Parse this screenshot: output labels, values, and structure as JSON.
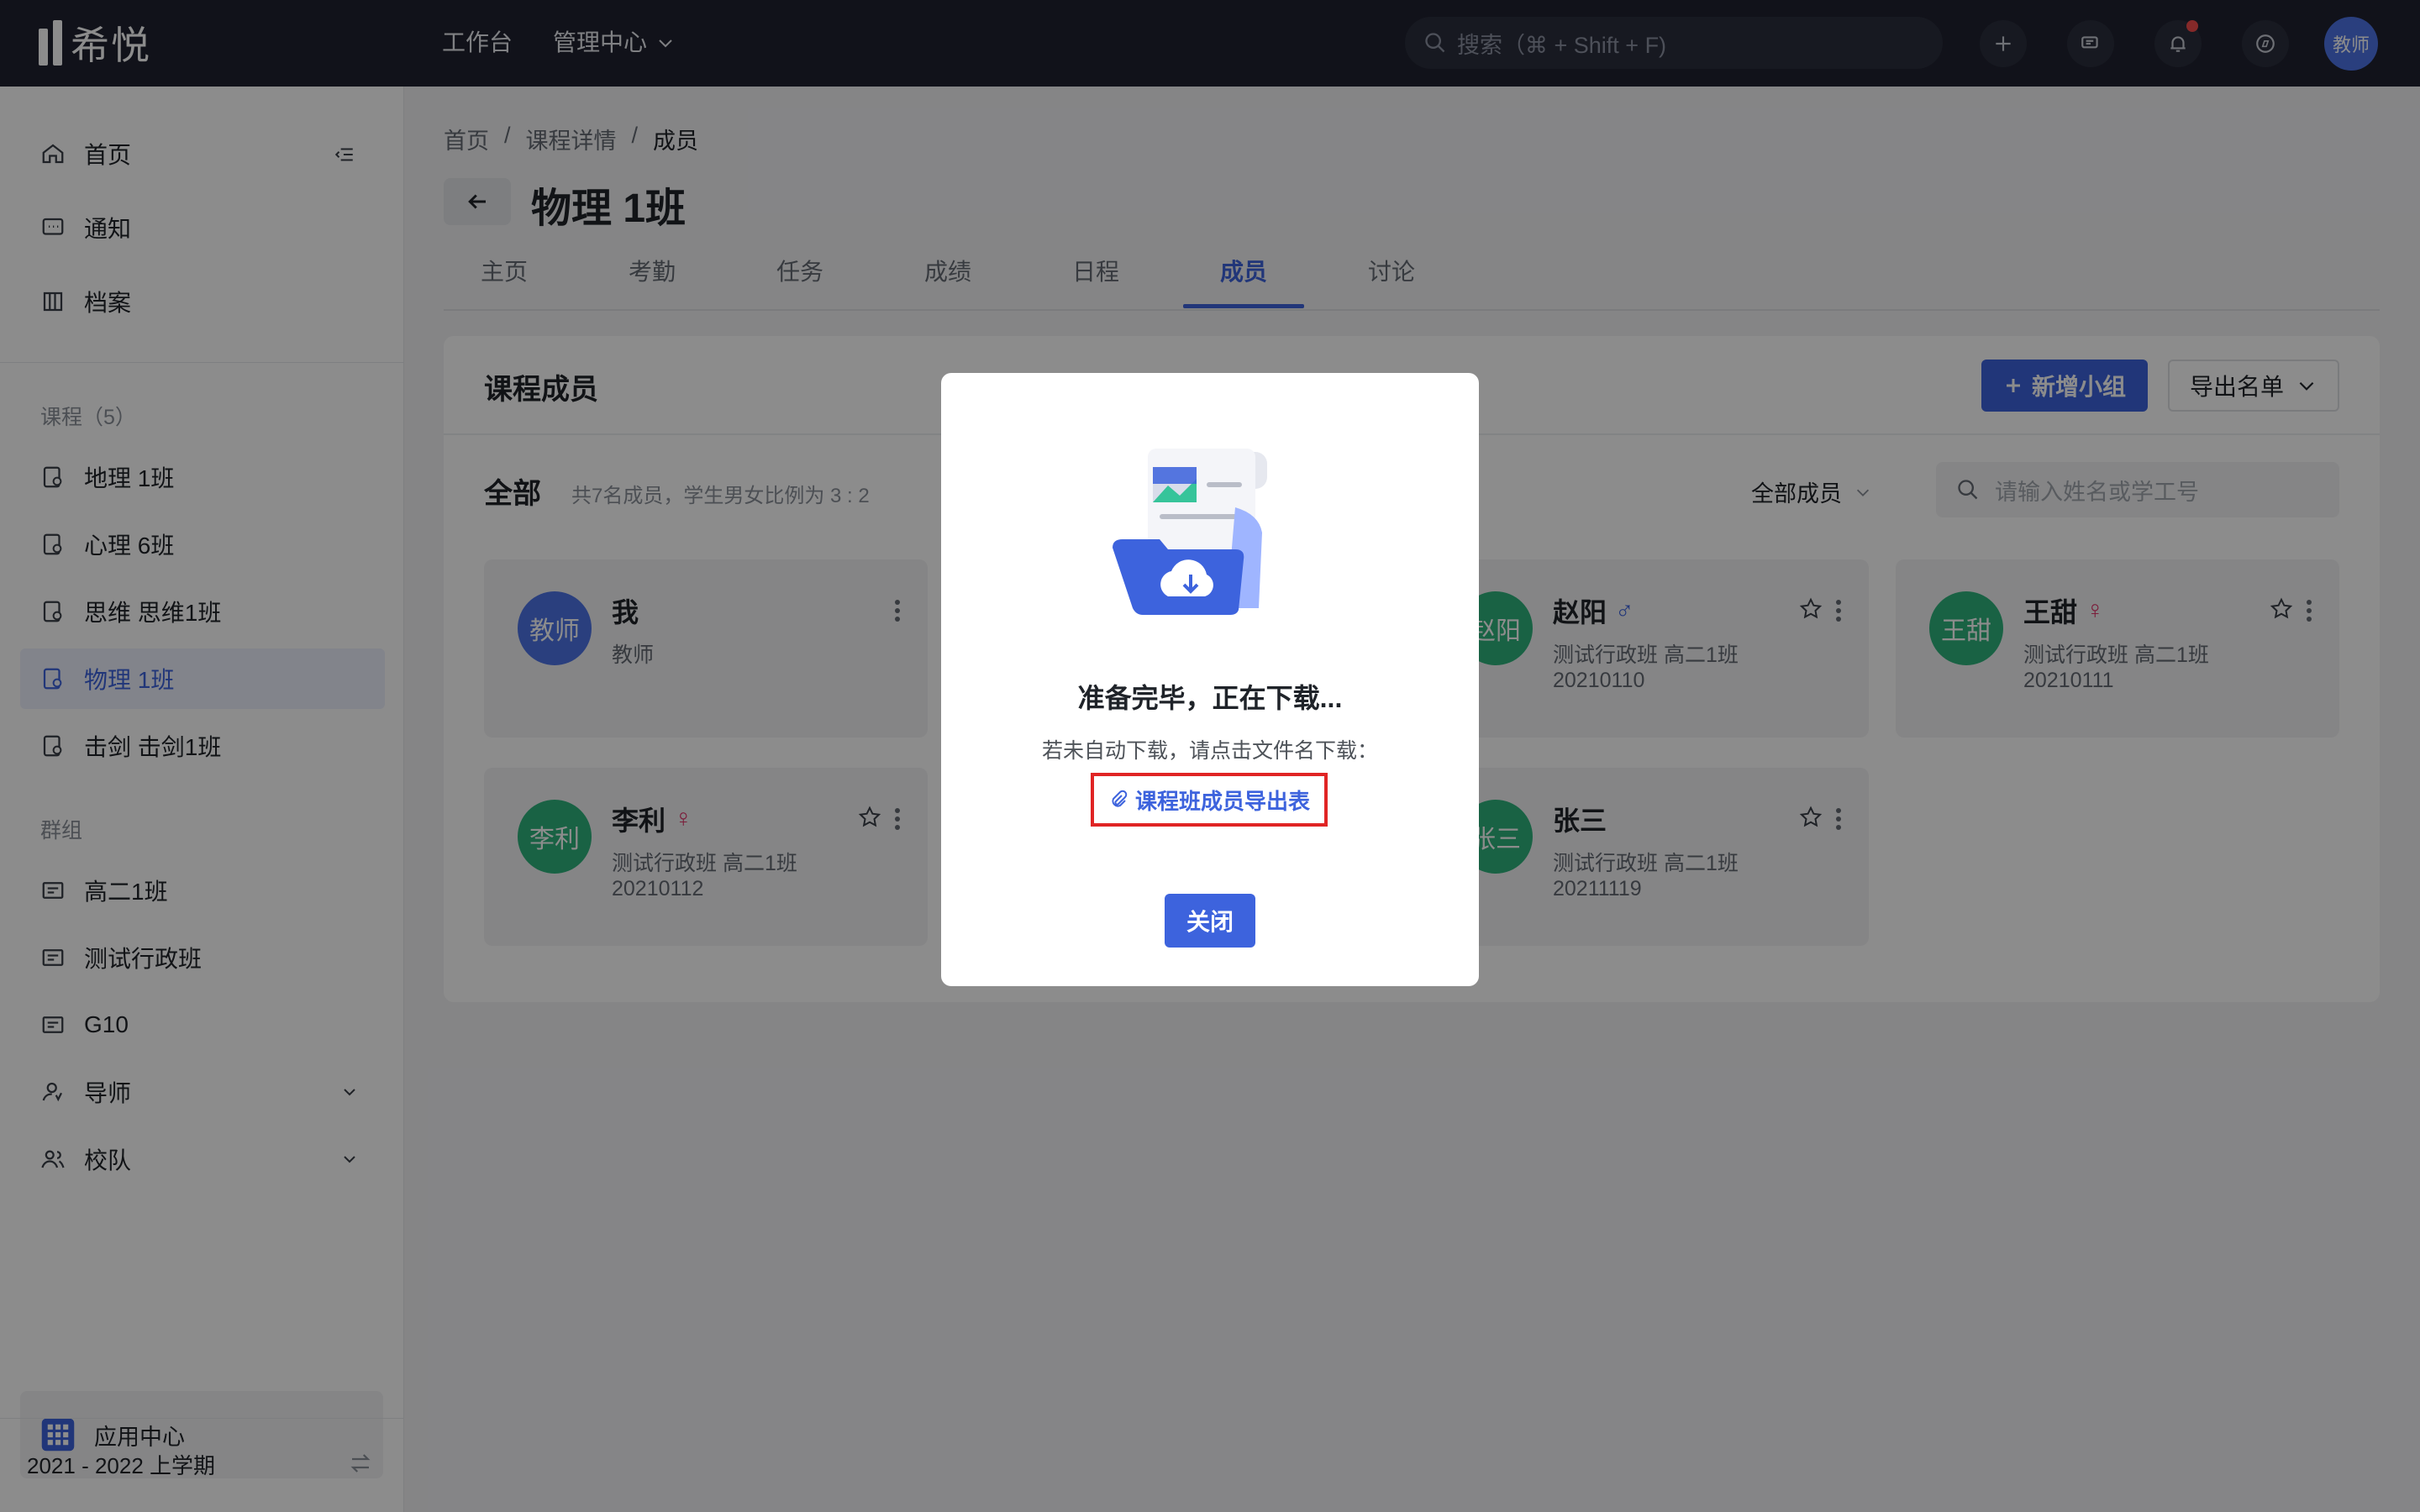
{
  "topbar": {
    "logo_text": "希悦",
    "nav_workbench": "工作台",
    "nav_admin": "管理中心",
    "search_placeholder": "搜索（⌘ + Shift + F)",
    "avatar_label": "教师"
  },
  "sidebar": {
    "home": "首页",
    "notice": "通知",
    "archive": "档案",
    "courses_header": "课程（5）",
    "courses": [
      "地理 1班",
      "心理 6班",
      "思维 思维1班",
      "物理 1班",
      "击剑 击剑1班"
    ],
    "groups_header": "群组",
    "groups": [
      "高二1班",
      "测试行政班",
      "G10",
      "导师",
      "校队"
    ],
    "app_center": "应用中心",
    "term": "2021 - 2022 上学期"
  },
  "breadcrumb": {
    "home": "首页",
    "sep": "/",
    "course": "课程详情",
    "current": "成员"
  },
  "page_title": "物理 1班",
  "tabs": [
    "主页",
    "考勤",
    "任务",
    "成绩",
    "日程",
    "成员",
    "讨论"
  ],
  "card": {
    "title": "课程成员",
    "add_group": "新增小组",
    "export_list": "导出名单",
    "all_label": "全部",
    "summary": "共7名成员，学生男女比例为 3 : 2",
    "filter": "全部成员",
    "search_placeholder": "请输入姓名或学工号"
  },
  "members": [
    {
      "avatar": "教师",
      "name": "我",
      "line1": "教师",
      "line2": ""
    },
    {
      "avatar": "赵阳",
      "name": "赵阳",
      "gender": "♂",
      "line1": "测试行政班 高二1班",
      "line2": "20210110"
    },
    {
      "avatar": "王甜",
      "name": "王甜",
      "gender": "♀",
      "line1": "测试行政班 高二1班",
      "line2": "20210111"
    },
    {
      "avatar": "李利",
      "name": "李利",
      "gender": "♀",
      "line1": "测试行政班 高二1班",
      "line2": "20210112"
    },
    {
      "avatar": "张三",
      "name": "张三",
      "line1": "测试行政班 高二1班",
      "line2": "20211119"
    }
  ],
  "modal": {
    "title": "准备完毕，正在下载...",
    "desc": "若未自动下载，请点击文件名下载：",
    "file_link": "课程班成员导出表",
    "close": "关闭"
  },
  "colors": {
    "primary": "#3d63dd",
    "topbar": "#1f2230",
    "avatar_green": "#2fb37c",
    "avatar_blue": "#4d74e6",
    "highlight_red": "#e02424"
  }
}
